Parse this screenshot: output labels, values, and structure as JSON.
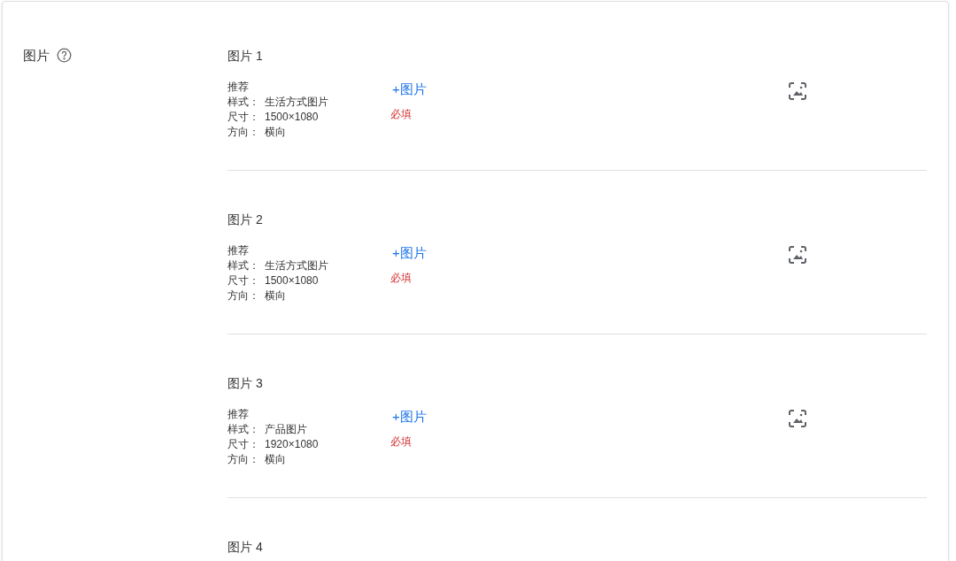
{
  "field_label": "图片",
  "slots": [
    {
      "title": "图片 1",
      "recommendation": "推荐",
      "specs": [
        {
          "label": "样式：",
          "value": "生活方式图片"
        },
        {
          "label": "尺寸：",
          "value": "1500×1080"
        },
        {
          "label": "方向：",
          "value": "横向"
        }
      ],
      "add_button": "+图片",
      "required": "必填"
    },
    {
      "title": "图片 2",
      "recommendation": "推荐",
      "specs": [
        {
          "label": "样式：",
          "value": "生活方式图片"
        },
        {
          "label": "尺寸：",
          "value": "1500×1080"
        },
        {
          "label": "方向：",
          "value": "横向"
        }
      ],
      "add_button": "+图片",
      "required": "必填"
    },
    {
      "title": "图片 3",
      "recommendation": "推荐",
      "specs": [
        {
          "label": "样式：",
          "value": "产品图片"
        },
        {
          "label": "尺寸：",
          "value": "1920×1080"
        },
        {
          "label": "方向：",
          "value": "横向"
        }
      ],
      "add_button": "+图片",
      "required": "必填"
    },
    {
      "title": "图片 4"
    }
  ]
}
